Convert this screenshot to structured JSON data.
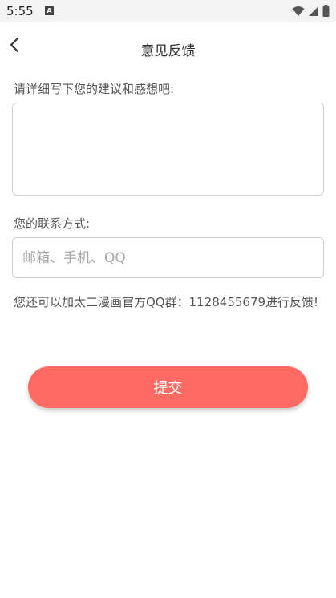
{
  "status_bar": {
    "time": "5:55",
    "a_icon_text": "A",
    "icons": [
      "wifi-icon",
      "cell-signal-icon",
      "battery-icon"
    ]
  },
  "app_bar": {
    "title": "意见反馈",
    "back_icon": "chevron-left-icon"
  },
  "form": {
    "suggestion_label": "请详细写下您的建议和感想吧:",
    "suggestion_value": "",
    "contact_label": "您的联系方式:",
    "contact_placeholder": "邮箱、手机、QQ",
    "contact_value": "",
    "qq_info": "您还可以加太二漫画官方QQ群：1128455679进行反馈!",
    "submit_label": "提交"
  },
  "colors": {
    "accent": "#ff6b63",
    "status_bar_bg": "#f3f3f3",
    "border": "#cfcfcf"
  }
}
